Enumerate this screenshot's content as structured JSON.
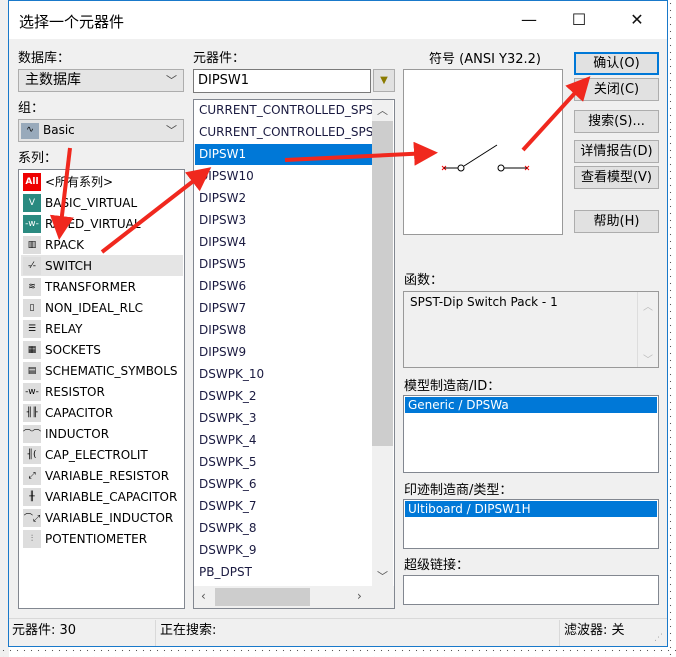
{
  "window": {
    "title": "选择一个元器件",
    "minimize": "—",
    "maximize": "☐",
    "close": "✕"
  },
  "database": {
    "label": "数据库：",
    "value": "主数据库"
  },
  "group": {
    "label": "组：",
    "value": "Basic",
    "icon": "basic-group-icon"
  },
  "family": {
    "label": "系列：",
    "items": [
      {
        "label": "<所有系列>",
        "icon": "All"
      },
      {
        "label": "BASIC_VIRTUAL",
        "icon": "V"
      },
      {
        "label": "RATED_VIRTUAL",
        "icon": "-w-"
      },
      {
        "label": "RPACK",
        "icon": "▥"
      },
      {
        "label": "SWITCH",
        "icon": "-⁄-"
      },
      {
        "label": "TRANSFORMER",
        "icon": "≋"
      },
      {
        "label": "NON_IDEAL_RLC",
        "icon": "▯"
      },
      {
        "label": "RELAY",
        "icon": "☰"
      },
      {
        "label": "SOCKETS",
        "icon": "▦"
      },
      {
        "label": "SCHEMATIC_SYMBOLS",
        "icon": "▤"
      },
      {
        "label": "RESISTOR",
        "icon": "-w-"
      },
      {
        "label": "CAPACITOR",
        "icon": "╢╟"
      },
      {
        "label": "INDUCTOR",
        "icon": "⌒⌒"
      },
      {
        "label": "CAP_ELECTROLIT",
        "icon": "╢("
      },
      {
        "label": "VARIABLE_RESISTOR",
        "icon": "⤢"
      },
      {
        "label": "VARIABLE_CAPACITOR",
        "icon": "╫"
      },
      {
        "label": "VARIABLE_INDUCTOR",
        "icon": "⌒⤢"
      },
      {
        "label": "POTENTIOMETER",
        "icon": "⫶"
      }
    ],
    "selected": "SWITCH"
  },
  "component": {
    "label": "元器件：",
    "value": "DIPSW1",
    "items": [
      "CURRENT_CONTROLLED_SPST",
      "CURRENT_CONTROLLED_SPST",
      "DIPSW1",
      "DIPSW10",
      "DIPSW2",
      "DIPSW3",
      "DIPSW4",
      "DIPSW5",
      "DIPSW6",
      "DIPSW7",
      "DIPSW8",
      "DIPSW9",
      "DSWPK_10",
      "DSWPK_2",
      "DSWPK_3",
      "DSWPK_4",
      "DSWPK_5",
      "DSWPK_6",
      "DSWPK_7",
      "DSWPK_8",
      "DSWPK_9",
      "PB_DPST"
    ],
    "selected": "DIPSW1"
  },
  "symbol": {
    "label": "符号 (ANSI Y32.2)"
  },
  "buttons": {
    "ok": "确认(O)",
    "close": "关闭(C)",
    "search": "搜索(S)...",
    "detail": "详情报告(D)",
    "model": "查看模型(V)",
    "help": "帮助(H)"
  },
  "function": {
    "label": "函数：",
    "value": "SPST-Dip Switch Pack - 1"
  },
  "model_mfr": {
    "label": "模型制造商/ID：",
    "value": "Generic / DPSWa"
  },
  "footprint": {
    "label": "印迹制造商/类型：",
    "value": "Ultiboard / DIPSW1H"
  },
  "hyperlink": {
    "label": "超级链接：",
    "value": ""
  },
  "status": {
    "count": "元器件:  30",
    "searching": "正在搜索:",
    "filter": "滤波器:  关"
  },
  "colors": {
    "accent": "#0078d7",
    "arrow": "#f0281e"
  }
}
